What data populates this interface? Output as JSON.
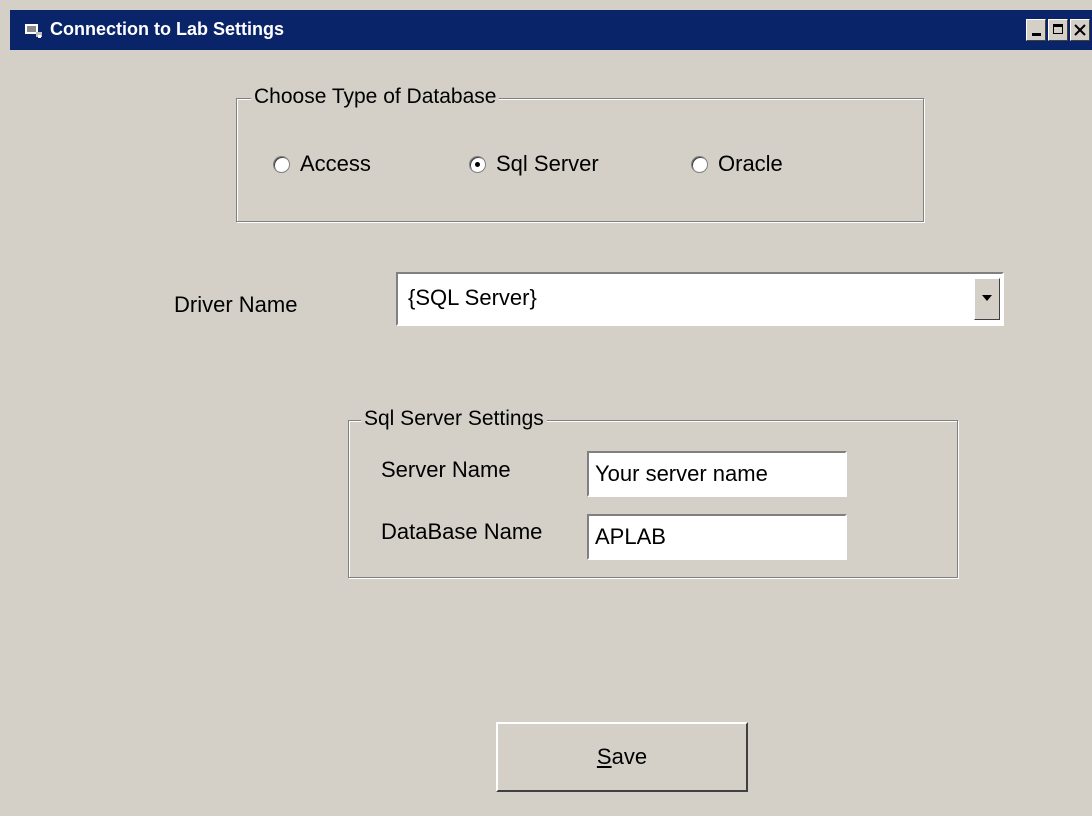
{
  "window": {
    "title": "Connection to Lab Settings",
    "titlebar_color": "#0a246a",
    "background_color": "#d4d0c8"
  },
  "database_type": {
    "legend": "Choose Type of Database",
    "options": [
      {
        "label": "Access",
        "selected": false
      },
      {
        "label": "Sql Server",
        "selected": true
      },
      {
        "label": "Oracle",
        "selected": false
      }
    ]
  },
  "driver": {
    "label": "Driver Name",
    "value": "{SQL Server}"
  },
  "sql_settings": {
    "legend": "Sql Server Settings",
    "server_label": "Server Name",
    "server_value": "Your server name",
    "database_label": "DataBase Name",
    "database_value": "APLAB"
  },
  "save": {
    "mnemonic": "S",
    "rest": "ave"
  }
}
